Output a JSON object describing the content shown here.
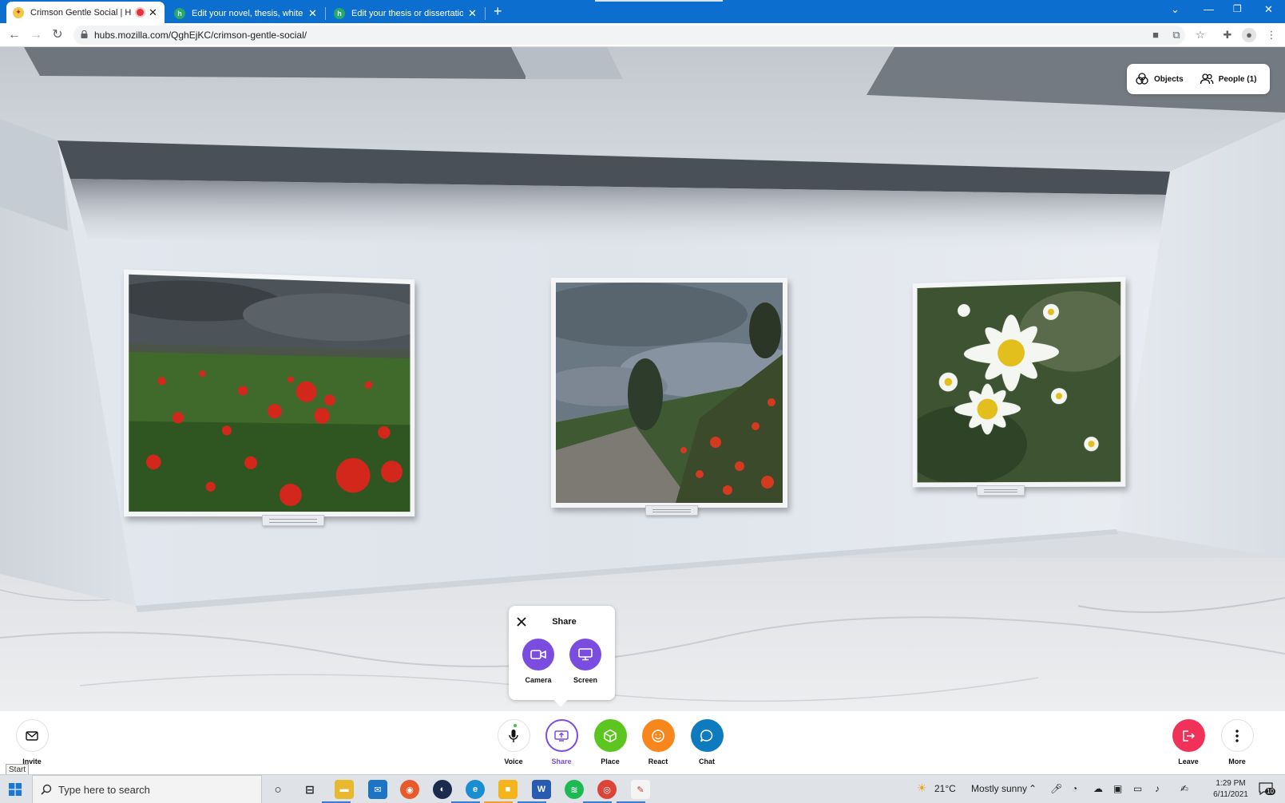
{
  "browser": {
    "tabs": [
      {
        "title": "Crimson Gentle Social | Hub",
        "favicon": "hubs-duck-icon",
        "recording": true,
        "active": true
      },
      {
        "title": "Edit your novel, thesis, white pap",
        "favicon": "scribendi-icon",
        "active": false
      },
      {
        "title": "Edit your thesis or dissertation b",
        "favicon": "scribendi-icon",
        "active": false
      }
    ],
    "new_tab_label": "+",
    "url": "hubs.mozilla.com/QghEjKC/crimson-gentle-social/"
  },
  "room": {
    "objects_label": "Objects",
    "people_label": "People (1)"
  },
  "share_popover": {
    "title": "Share",
    "options": [
      {
        "label": "Camera",
        "icon": "video-camera-icon"
      },
      {
        "label": "Screen",
        "icon": "monitor-icon"
      }
    ]
  },
  "bottom_bar": {
    "invite_label": "Invite",
    "voice_label": "Voice",
    "share_label": "Share",
    "place_label": "Place",
    "react_label": "React",
    "chat_label": "Chat",
    "leave_label": "Leave",
    "more_label": "More",
    "start_tooltip": "Start",
    "colors": {
      "place": "#5cc51f",
      "react": "#f7861c",
      "chat": "#0f7bbf",
      "leave": "#f0325a",
      "share_accent": "#7b4ce0"
    }
  },
  "taskbar": {
    "search_placeholder": "Type here to search",
    "weather_temp": "21°C",
    "weather_text": "Mostly sunny",
    "time": "1:29 PM",
    "date": "6/11/2021",
    "notification_count": "10"
  }
}
